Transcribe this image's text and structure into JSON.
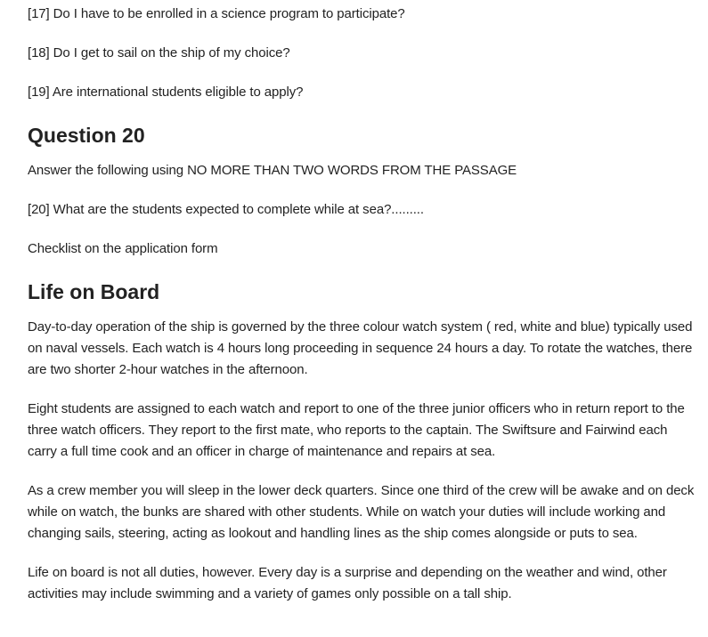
{
  "questions_top": [
    "[17] Do I have to be enrolled in a science program to participate?",
    "[18] Do I get to sail on the ship of my choice?",
    "[19] Are international students eligible to apply?"
  ],
  "question20": {
    "heading": "Question 20",
    "instruction": "Answer the following using NO MORE THAN TWO WORDS FROM THE PASSAGE",
    "question": "[20] What are the students expected to complete while at sea?.........",
    "note": "Checklist on the application form"
  },
  "life_on_board": {
    "heading": "Life on Board",
    "paragraphs": [
      "Day-to-day operation of the ship is governed by the three colour watch system ( red, white and blue) typically used on naval vessels. Each watch is 4 hours long proceeding in sequence 24 hours a day. To rotate the watches, there are two shorter 2-hour watches in the afternoon.",
      "Eight students are assigned to each watch and report to one of the three junior officers who in return report to the three watch officers. They report to the first mate, who reports to the captain. The Swiftsure and Fairwind each carry a full time cook and an officer in charge of maintenance and repairs at sea.",
      "As a crew member you will sleep in the lower deck quarters. Since one third of the crew will be awake and on deck while on watch, the bunks are shared with other students. While on watch your duties will include working and changing sails, steering, acting as lookout and handling lines as the ship comes alongside or puts to sea.",
      "Life on board is not all duties, however. Every day is a surprise and depending on the weather and wind, other activities may include swimming and a variety of games only possible on a tall ship."
    ]
  }
}
